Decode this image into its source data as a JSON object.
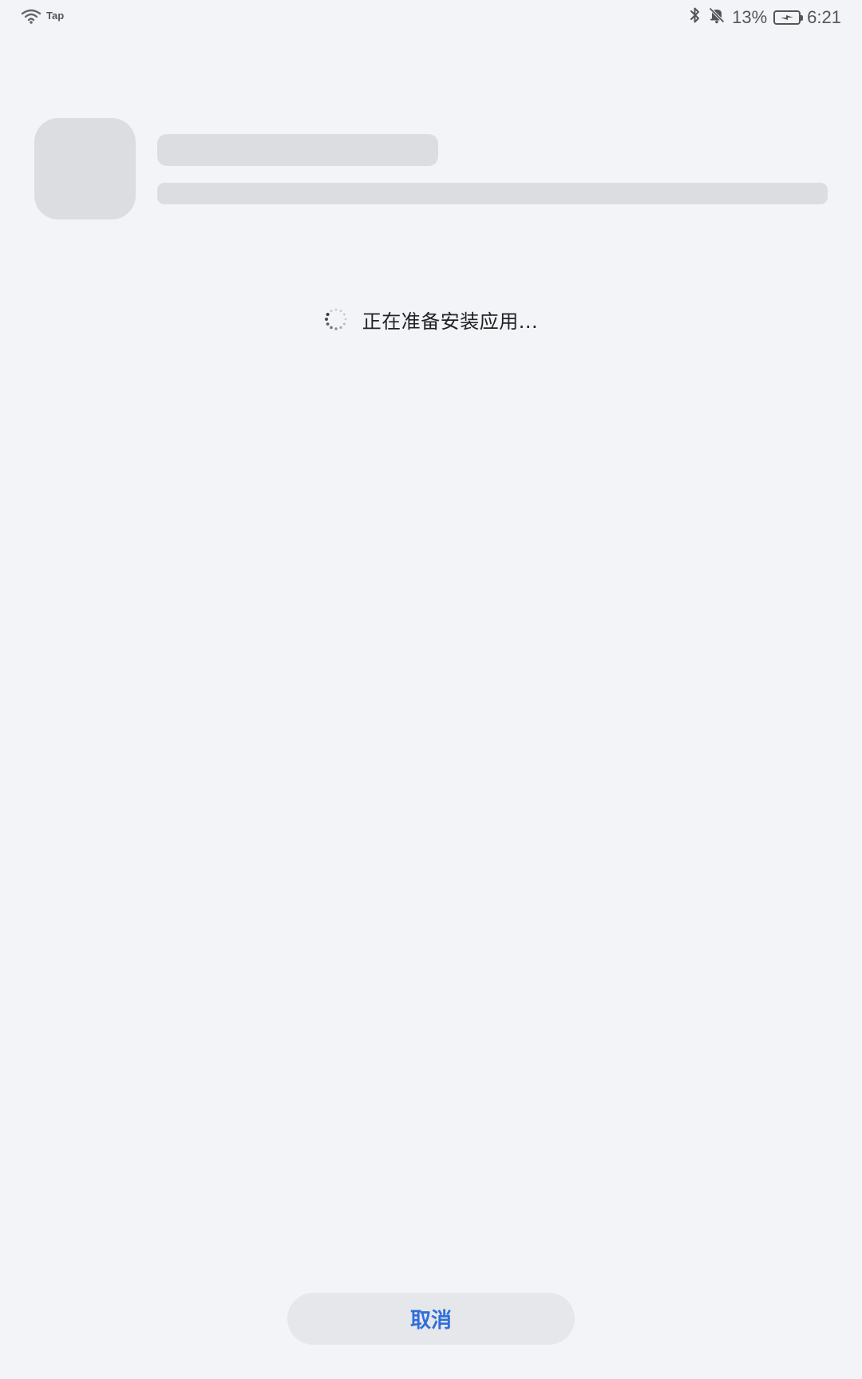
{
  "status_bar": {
    "carrier_label": "Tap",
    "battery_percent": "13%",
    "time": "6:21",
    "icons": {
      "wifi": "wifi-icon",
      "bluetooth": "bluetooth-icon",
      "silent": "bell-off-icon",
      "battery": "battery-charging-icon"
    }
  },
  "loading": {
    "message": "正在准备安装应用..."
  },
  "actions": {
    "cancel_label": "取消"
  },
  "colors": {
    "background": "#f2f4f8",
    "placeholder": "#dcdde1",
    "button_background": "#e6e7eb",
    "accent": "#2f6fd9"
  }
}
